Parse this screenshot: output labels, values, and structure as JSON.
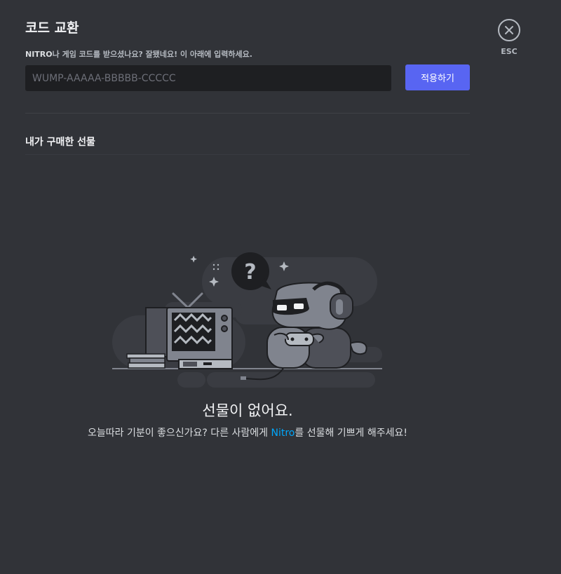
{
  "header": {
    "title": "코드 교환",
    "subtitle_brand": "NITRO",
    "subtitle_text": "나 게임 코드를 받으셨나요? 잘됐네요! 이 아래에 입력하세요."
  },
  "code_input": {
    "placeholder": "WUMP-AAAAA-BBBBB-CCCCC",
    "value": ""
  },
  "apply_button": {
    "label": "적용하기"
  },
  "close": {
    "esc_label": "ESC",
    "icon": "close-icon"
  },
  "gifts_section": {
    "title": "내가 구매한 선물"
  },
  "empty_state": {
    "title": "선물이 없어요.",
    "desc_before": "오늘따라 기분이 좋으신가요? 다른 사람에게 ",
    "desc_link": "Nitro",
    "desc_after": "를 선물해 기쁘게 해주세요!",
    "illustration": "wumpus-gaming-illustration"
  },
  "colors": {
    "background": "#313338",
    "input_background": "#1e1f22",
    "brand": "#5865f2",
    "link": "#00a8fc"
  }
}
